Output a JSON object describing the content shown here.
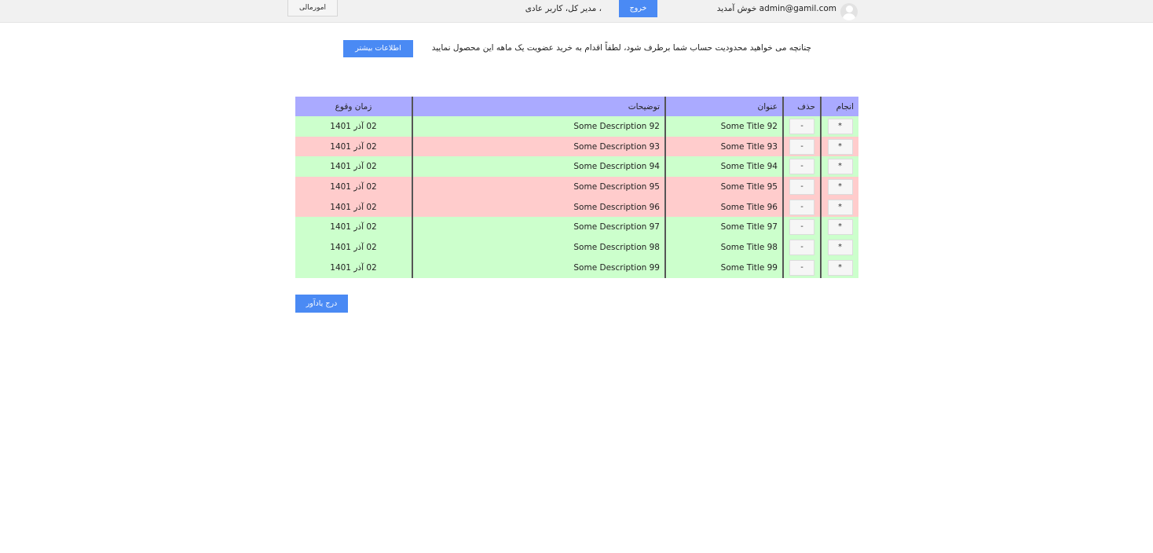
{
  "header": {
    "finance_label": "امورمالی",
    "roles_text": "، مدیر کل، کاربر عادی",
    "logout_label": "خروج",
    "welcome_text": "خوش آمدید",
    "user_email": "admin@gamil.com",
    "avatar_icon": "user-avatar-icon"
  },
  "notice": {
    "text": "چنانچه می خواهید محدودیت حساب شما برطرف شود، لطفاً اقدام به خرید عضویت یک ماهه این محصول نمایید",
    "button_label": "اطلاعات بیشتر"
  },
  "table": {
    "headers": {
      "done": "انجام",
      "delete": "حذف",
      "title": "عنوان",
      "description": "توضیحات",
      "time": "زمان وقوع"
    },
    "done_button_label": "*",
    "delete_button_label": "-",
    "row_colors": {
      "done": "#ccffcc",
      "pending": "#ffcccc"
    },
    "rows": [
      {
        "title": "Some Title 92",
        "description": "Some Description 92",
        "date": "02 آذر 1401",
        "status": "green"
      },
      {
        "title": "Some Title 93",
        "description": "Some Description 93",
        "date": "02 آذر 1401",
        "status": "red"
      },
      {
        "title": "Some Title 94",
        "description": "Some Description 94",
        "date": "02 آذر 1401",
        "status": "green"
      },
      {
        "title": "Some Title 95",
        "description": "Some Description 95",
        "date": "02 آذر 1401",
        "status": "red"
      },
      {
        "title": "Some Title 96",
        "description": "Some Description 96",
        "date": "02 آذر 1401",
        "status": "red"
      },
      {
        "title": "Some Title 97",
        "description": "Some Description 97",
        "date": "02 آذر 1401",
        "status": "green"
      },
      {
        "title": "Some Title 98",
        "description": "Some Description 98",
        "date": "02 آذر 1401",
        "status": "green"
      },
      {
        "title": "Some Title 99",
        "description": "Some Description 99",
        "date": "02 آذر 1401",
        "status": "green"
      }
    ]
  },
  "add_reminder_label": "درج یادآور",
  "colors": {
    "accent": "#4a8af4",
    "table_header": "#aaaaff"
  }
}
